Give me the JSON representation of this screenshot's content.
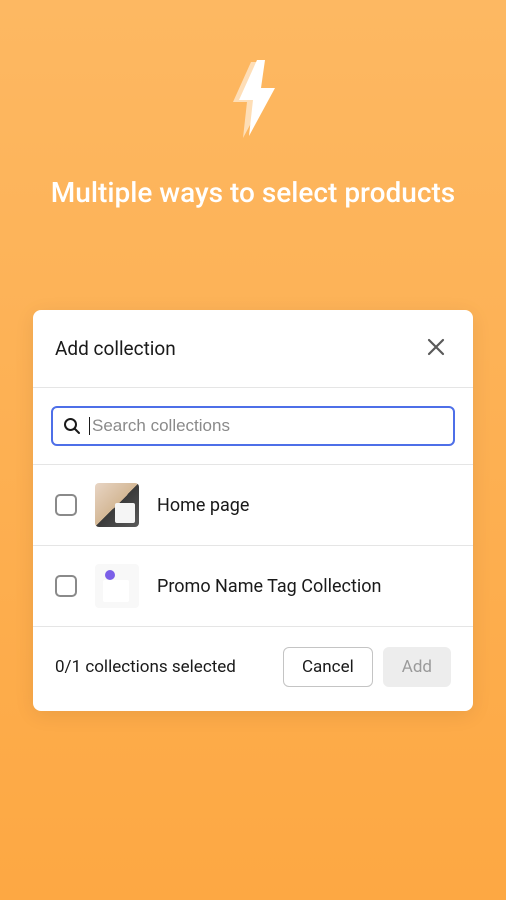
{
  "hero": {
    "title": "Multiple ways to select products"
  },
  "modal": {
    "title": "Add collection",
    "search": {
      "placeholder": "Search collections",
      "value": ""
    },
    "items": [
      {
        "label": "Home page",
        "checked": false
      },
      {
        "label": "Promo Name Tag Collection",
        "checked": false
      }
    ],
    "footer": {
      "status": "0/1 collections selected",
      "cancel": "Cancel",
      "add": "Add"
    }
  }
}
